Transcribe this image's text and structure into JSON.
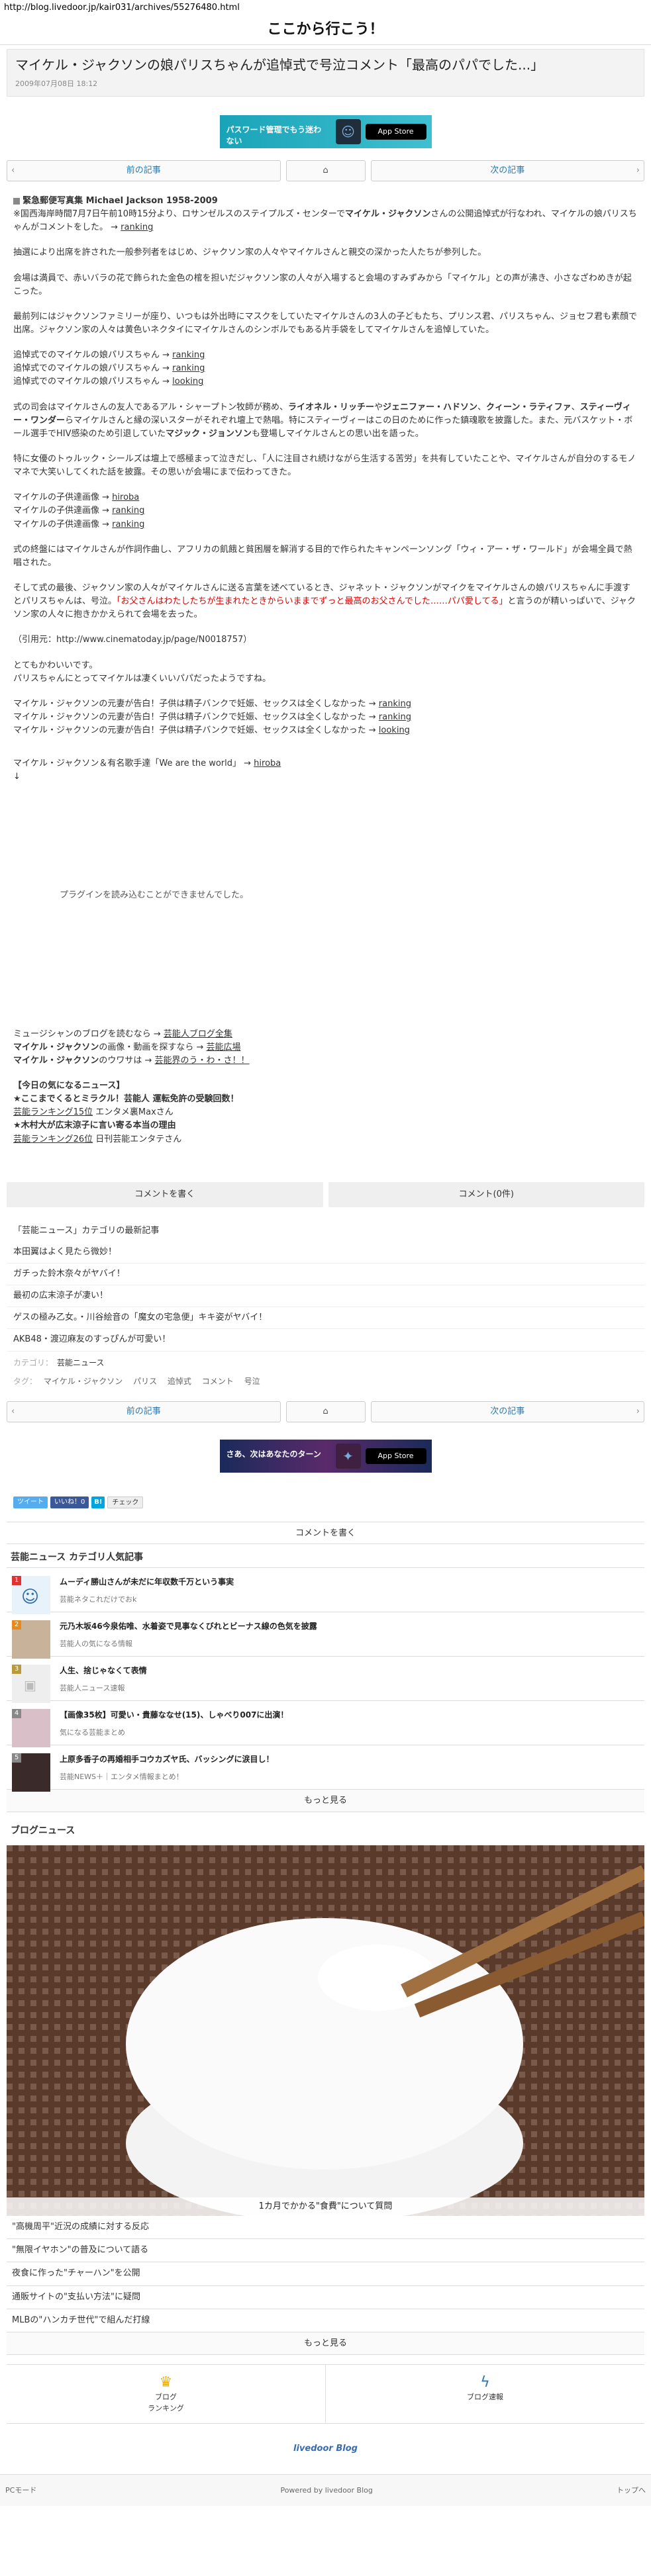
{
  "url": "http://blog.livedoor.jp/kair031/archives/55276480.html",
  "blog_title": "ここから行こう！",
  "article": {
    "title": "マイケル・ジャクソンの娘パリスちゃんが追悼式で号泣コメント「最高のパパでした...」",
    "date": "2009年07月08日 18:12"
  },
  "banner_top": {
    "text": "パスワード管理でもう迷わない",
    "store": "App Store"
  },
  "nav": {
    "prev": "前の記事",
    "next": "次の記事",
    "home_icon": "home-icon"
  },
  "body": {
    "photo_caption": "緊急郵便写真集 Michael Jackson 1958-2009",
    "p1_a": "※国西海岸時間7月7日午前10時15分より、ロサンゼルスのステイプルズ・センターで",
    "p1_b": "マイケル・ジャクソン",
    "p1_c": "さんの公開追悼式が行なわれ、マイケルの娘パリスちゃんがコメントをした。 →",
    "p1_link": "ranking",
    "p2": "抽選により出席を許された一般参列者をはじめ、ジャクソン家の人々やマイケルさんと親交の深かった人たちが参列した。",
    "p3": "会場は満員で、赤いバラの花で飾られた金色の棺を担いだジャクソン家の人々が入場すると会場のすみずみから「マイケル」との声が沸き、小さなざわめきが起こった。",
    "p4": "最前列にはジャクソンファミリーが座り、いつもは外出時にマスクをしていたマイケルさんの3人の子どもたち、プリンス君、パリスちゃん、ジョセフ君も素顔で出席。ジャクソン家の人々は黄色いネクタイにマイケルさんのシンボルでもある片手袋をしてマイケルさんを追悼していた。",
    "links1": [
      {
        "text": "追悼式でのマイケルの娘パリスちゃん →",
        "link": "ranking"
      },
      {
        "text": "追悼式でのマイケルの娘パリスちゃん →",
        "link": "ranking"
      },
      {
        "text": "追悼式でのマイケルの娘パリスちゃん →",
        "link": "looking"
      }
    ],
    "p5_a": "式の司会はマイケルさんの友人であるアル・シャープトン牧師が務め、",
    "p5_b": "ライオネル・リッチー",
    "p5_c": "や",
    "p5_d": "ジェニファー・ハドソン",
    "p5_e": "、",
    "p5_f": "クィーン・ラティファ",
    "p5_g": "、",
    "p5_h": "スティーヴィー・ワンダー",
    "p5_i": "らマイケルさんと縁の深いスターがそれぞれ壇上で熱唱。特にスティーヴィーはこの日のために作った鎮魂歌を披露した。また、元バスケット・ボール選手でHIV感染のため引退していた",
    "p5_j": "マジック・ジョンソン",
    "p5_k": "も登場しマイケルさんとの思い出を語った。",
    "p6": "特に女優のトゥルック・シールズは壇上で感極まって泣きだし、「人に注目され続けながら生活する苦労」を共有していたことや、マイケルさんが自分のするモノマネで大笑いしてくれた話を披露。その思いが会場にまで伝わってきた。",
    "links2": [
      {
        "text": "マイケルの子供達画像 →",
        "link": "hiroba"
      },
      {
        "text": "マイケルの子供達画像 →",
        "link": "ranking"
      },
      {
        "text": "マイケルの子供達画像 →",
        "link": "ranking"
      }
    ],
    "p7": "式の終盤にはマイケルさんが作詞作曲し、アフリカの飢餓と貧困層を解消する目的で作られたキャンペーンソング「ウィ・アー・ザ・ワールド」が会場全員で熱唱された。",
    "p8_a": "そして式の最後、ジャクソン家の人々がマイケルさんに送る言葉を述べているとき、ジャネット・ジャクソンがマイクをマイケルさんの娘パリスちゃんに手渡すとパリスちゃんは、号泣。",
    "p8_red": "「お父さんはわたしたちが生まれたときからいままでずっと最高のお父さんでした……パパ愛してる」",
    "p8_b": "と言うのが精いっぱいで、ジャクソン家の人々に抱きかかえられて会場を去った。",
    "quote_source": "（引用元：http://www.cinematoday.jp/page/N0018757）",
    "p9_a": "とてもかわいいです。",
    "p9_b": "パリスちゃんにとってマイケルは凄くいいパパだったようですね。",
    "links3": [
      {
        "text": "マイケル・ジャクソンの元妻が告白！子供は精子バンクで妊娠、セックスは全くしなかった →",
        "link": "ranking"
      },
      {
        "text": "マイケル・ジャクソンの元妻が告白！子供は精子バンクで妊娠、セックスは全くしなかった →",
        "link": "ranking"
      },
      {
        "text": "マイケル・ジャクソンの元妻が告白！子供は精子バンクで妊娠、セックスは全くしなかった →",
        "link": "looking"
      }
    ],
    "we_are_text": "マイケル・ジャクソン＆有名歌手達「We are the world」 →",
    "we_are_link": "hiroba",
    "plugin_text": "プラグインを読み込むことができませんでした。",
    "related": [
      {
        "a": "ミュージシャンのブログを読むなら →",
        "link": "芸能人ブログ全集",
        "b": ""
      },
      {
        "a": "マイケル・ジャクソン",
        "b": "の画像・動画を探すなら →",
        "link": "芸能広場"
      },
      {
        "a": "マイケル・ジャクソン",
        "b": "のウワサは →",
        "link": "芸能界のう・わ・さ！！"
      }
    ],
    "today_title": "【今日の気になるニュース】",
    "today": [
      "★ここまでくるとミラクル！芸能人 運転免許の受験回数！",
      "芸能ランキング15位",
      "エンタメ裏Maxさん",
      "★木村大が広末涼子に言い寄る本当の理由",
      "芸能ランキング26位",
      "日刊芸能エンタテさん"
    ]
  },
  "buttons": {
    "write": "コメントを書く",
    "count": "コメント(0件)"
  },
  "category_box": {
    "title": "「芸能ニュース」カテゴリの最新記事",
    "items": [
      "本田翼はよく見たら微妙！",
      "ガチった鈴木奈々がヤバイ！",
      "最初の広末涼子が凄い！",
      "ゲスの極み乙女。・川谷絵音の「魔女の宅急便」キキ姿がヤバイ！",
      "AKB48・渡辺麻友のすっぴんが可愛い！"
    ]
  },
  "meta": {
    "category_label": "カテゴリ：",
    "category": "芸能ニュース",
    "tags_label": "タグ：",
    "tags": [
      "マイケル・ジャクソン",
      "パリス",
      "追悼式",
      "コメント",
      "号泣"
    ]
  },
  "banner_bottom": {
    "text": "さあ、次はあなたのターン",
    "store": "App Store"
  },
  "share": {
    "tweet": "ツイート",
    "like": "いいね！0",
    "hatena": "B!",
    "check": "チェック"
  },
  "comment_write": "コメントを書く",
  "ranking": {
    "title": "芸能ニュース カテゴリ人気記事",
    "items": [
      {
        "num": "1",
        "headline": "ムーディ勝山さんが未だに年収数千万という事実",
        "sub": "芸能ネタこれだけでおk"
      },
      {
        "num": "2",
        "headline": "元乃木坂46今泉佑唯、水着姿で見事なくびれとビーナス線の色気を披露",
        "sub": "芸能人の気になる情報"
      },
      {
        "num": "3",
        "headline": "人生、捨じゃなくて表情",
        "sub": "芸能人ニュース速報"
      },
      {
        "num": "4",
        "headline": "【画像35枚】可愛い・貴藤ななせ(15)、しゃべり007に出演！",
        "sub": "気になる芸能まとめ"
      },
      {
        "num": "5",
        "headline": "上原多香子の再婚相手コウカズヤ氏、バッシングに涙目し！",
        "sub": "芸能NEWS＋｜エンタメ情報まとめ！"
      }
    ],
    "more": "もっと見る"
  },
  "blog_news": {
    "title": "ブログニュース",
    "caption": "1カ月でかかる\"食費\"について質問",
    "items": [
      "\"高機周平\"近況の成績に対する反応",
      "\"無限イヤホン\"の普及について語る",
      "夜食に作った\"チャーハン\"を公開",
      "通販サイトの\"支払い方法\"に疑問",
      "MLBの\"ハンカチ世代\"で組んだ打線"
    ],
    "more": "もっと見る"
  },
  "footer_links": [
    {
      "icon": "crown-icon",
      "label_a": "ブログ",
      "label_b": "ランキング"
    },
    {
      "icon": "lightning-icon",
      "label_a": "ブログ速報",
      "label_b": ""
    }
  ],
  "livedoor": "livedoor Blog",
  "bottom": {
    "pc": "PCモード",
    "powered": "Powered by livedoor Blog",
    "top": "トップへ"
  }
}
